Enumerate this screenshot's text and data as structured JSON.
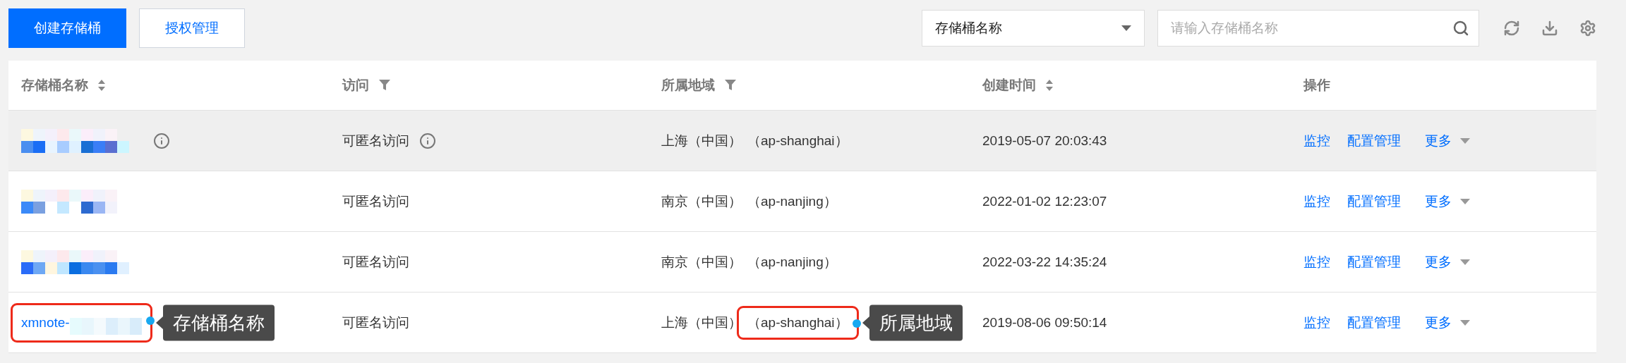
{
  "toolbar": {
    "buttons": [
      {
        "label": "创建存储桶",
        "kind": "primary"
      },
      {
        "label": "授权管理",
        "kind": "default"
      }
    ],
    "filter_select": {
      "value": "存储桶名称"
    },
    "search": {
      "placeholder": "请输入存储桶名称"
    }
  },
  "table": {
    "columns": [
      {
        "label": "存储桶名称",
        "kind": "sort"
      },
      {
        "label": "访问",
        "kind": "filter"
      },
      {
        "label": "所属地域",
        "kind": "filter"
      },
      {
        "label": "创建时间",
        "kind": "sort"
      },
      {
        "label": "操作",
        "kind": "plain"
      }
    ],
    "rows": [
      {
        "highlighted": true,
        "name_info": true,
        "access": "可匿名访问",
        "access_info": true,
        "region": "上海（中国）",
        "region_code": "（ap-shanghai）",
        "created": "2019-05-07 20:03:43",
        "actions": [
          "监控",
          "配置管理"
        ],
        "more": "更多"
      },
      {
        "highlighted": false,
        "name_info": false,
        "access": "可匿名访问",
        "access_info": false,
        "region": "南京（中国）",
        "region_code": "（ap-nanjing）",
        "created": "2022-01-02 12:23:07",
        "actions": [
          "监控",
          "配置管理"
        ],
        "more": "更多"
      },
      {
        "highlighted": false,
        "name_info": false,
        "access": "可匿名访问",
        "access_info": false,
        "region": "南京（中国）",
        "region_code": "（ap-nanjing）",
        "created": "2022-03-22 14:35:24",
        "actions": [
          "监控",
          "配置管理"
        ],
        "more": "更多"
      },
      {
        "highlighted": false,
        "name": {
          "kind": "picture",
          "prefix": "xmnote-",
          "callout": "存储桶名称"
        },
        "name_info": false,
        "access": "可匿名访问",
        "access_info": false,
        "region": "上海（中国）",
        "region_code": "（ap-shanghai）",
        "region_callout": "所属地域",
        "created": "2019-08-06 09:50:14",
        "actions": [
          "监控",
          "配置管理"
        ],
        "more": "更多"
      }
    ]
  }
}
